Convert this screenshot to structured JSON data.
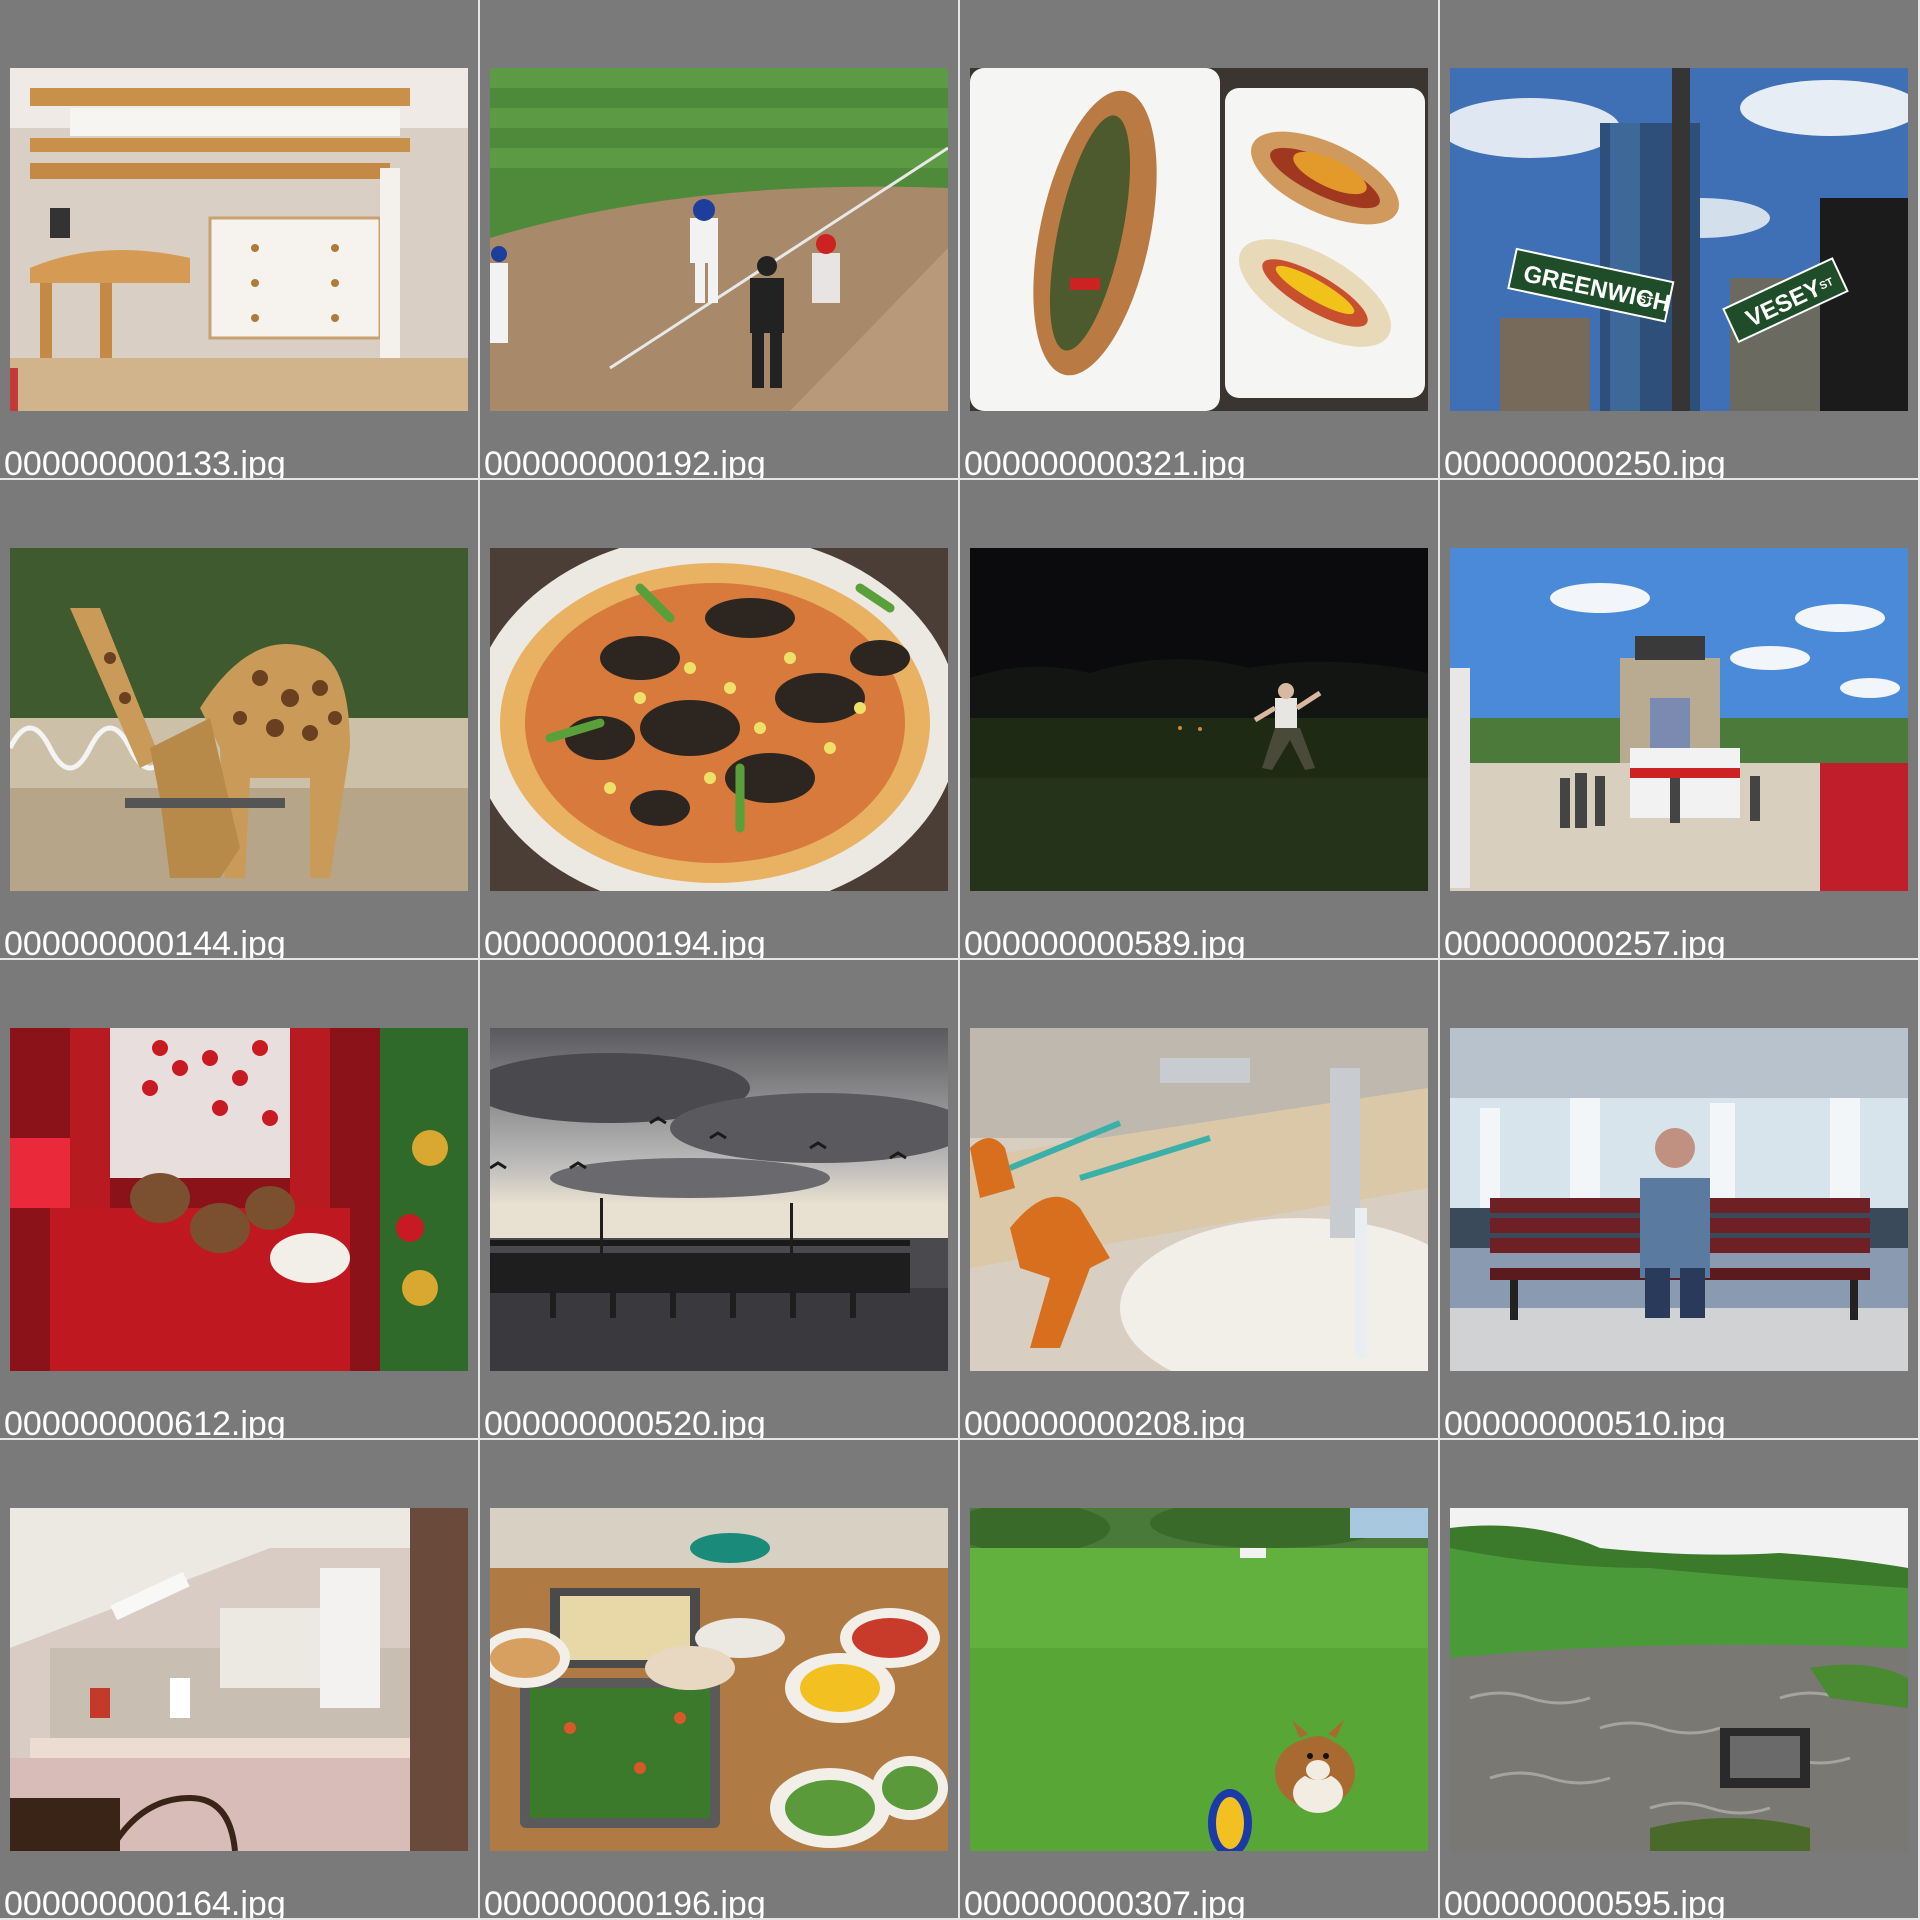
{
  "gallery": {
    "items": [
      {
        "filename": "000000000133.jpg",
        "scene": "bunk-bed-room"
      },
      {
        "filename": "000000000192.jpg",
        "scene": "baseball-field"
      },
      {
        "filename": "000000000321.jpg",
        "scene": "hot-dogs"
      },
      {
        "filename": "000000000250.jpg",
        "scene": "street-signs"
      },
      {
        "filename": "000000000144.jpg",
        "scene": "giraffes"
      },
      {
        "filename": "000000000194.jpg",
        "scene": "pizza"
      },
      {
        "filename": "000000000589.jpg",
        "scene": "night-field"
      },
      {
        "filename": "000000000257.jpg",
        "scene": "plaza-trucks"
      },
      {
        "filename": "000000000612.jpg",
        "scene": "red-bedroom"
      },
      {
        "filename": "000000000520.jpg",
        "scene": "pier-sunset"
      },
      {
        "filename": "000000000208.jpg",
        "scene": "bathroom-sink"
      },
      {
        "filename": "000000000510.jpg",
        "scene": "man-on-bench"
      },
      {
        "filename": "000000000164.jpg",
        "scene": "kitchen"
      },
      {
        "filename": "000000000196.jpg",
        "scene": "food-table"
      },
      {
        "filename": "000000000307.jpg",
        "scene": "dog-in-grass"
      },
      {
        "filename": "000000000595.jpg",
        "scene": "river-tv"
      }
    ],
    "signs": {
      "street1": "GREENWICH",
      "street1_suffix": "ST",
      "street2": "VESEY",
      "street2_suffix": "ST"
    }
  }
}
